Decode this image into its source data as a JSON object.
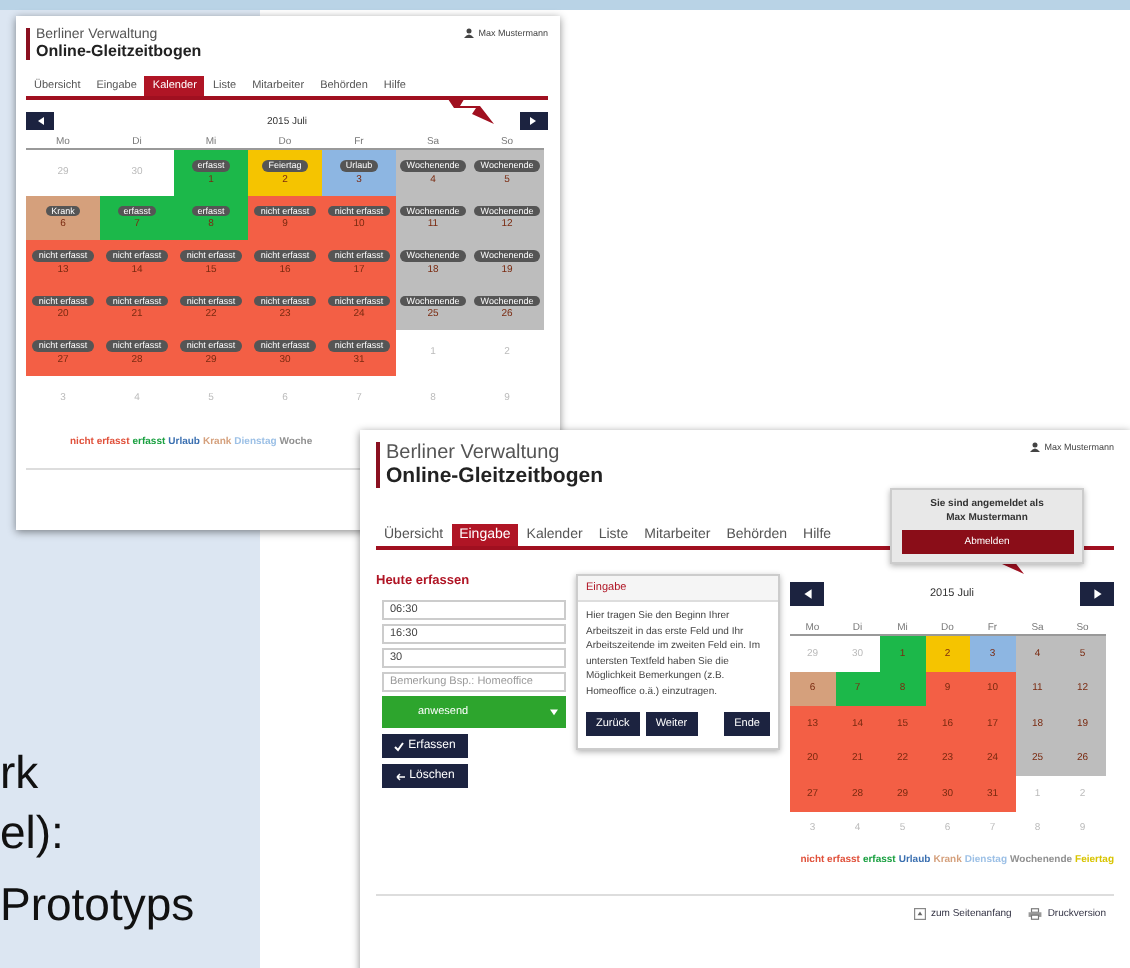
{
  "slide_text": [
    "rk",
    "el):",
    "Prototyps"
  ],
  "window_1": {
    "header": {
      "line_1": "Berliner Verwaltung",
      "line_2": "Online-Gleitzeitbogen"
    },
    "user": "Max Mustermann",
    "tabs": [
      {
        "label": "Übersicht",
        "selected": false
      },
      {
        "label": "Eingabe",
        "selected": false
      },
      {
        "label": "Kalender",
        "selected": true
      },
      {
        "label": "Liste",
        "selected": false
      },
      {
        "label": "Mitarbeiter",
        "selected": false
      },
      {
        "label": "Behörden",
        "selected": false
      },
      {
        "label": "Hilfe",
        "selected": false
      }
    ],
    "calendar": {
      "month": "2015 Juli",
      "weekdays": [
        "Mo",
        "Di",
        "Mi",
        "Do",
        "Fr",
        "Sa",
        "So"
      ],
      "weeks": [
        [
          {
            "day": "29",
            "color": "#ffffff"
          },
          {
            "day": "30",
            "color": "#ffffff"
          },
          {
            "day": "1",
            "color": "#1cb84a",
            "badge": "erfasst"
          },
          {
            "day": "2",
            "color": "#f5c400",
            "badge": "Feiertag"
          },
          {
            "day": "3",
            "color": "#8db6e2",
            "badge": "Urlaub"
          },
          {
            "day": "4",
            "color": "#bdbdbd",
            "badge": "Wochenende"
          },
          {
            "day": "5",
            "color": "#bdbdbd",
            "badge": "Wochenende"
          }
        ],
        [
          {
            "day": "6",
            "color": "#d5a07c",
            "badge": "Krank"
          },
          {
            "day": "7",
            "color": "#1cb84a",
            "badge": "erfasst"
          },
          {
            "day": "8",
            "color": "#1cb84a",
            "badge": "erfasst"
          },
          {
            "day": "9",
            "color": "#f35f45",
            "badge": "nicht erfasst"
          },
          {
            "day": "10",
            "color": "#f35f45",
            "badge": "nicht erfasst"
          },
          {
            "day": "11",
            "color": "#bdbdbd",
            "badge": "Wochenende"
          },
          {
            "day": "12",
            "color": "#bdbdbd",
            "badge": "Wochenende"
          }
        ],
        [
          {
            "day": "13",
            "color": "#f35f45",
            "badge": "nicht erfasst"
          },
          {
            "day": "14",
            "color": "#f35f45",
            "badge": "nicht erfasst"
          },
          {
            "day": "15",
            "color": "#f35f45",
            "badge": "nicht erfasst"
          },
          {
            "day": "16",
            "color": "#f35f45",
            "badge": "nicht erfasst"
          },
          {
            "day": "17",
            "color": "#f35f45",
            "badge": "nicht erfasst"
          },
          {
            "day": "18",
            "color": "#bdbdbd",
            "badge": "Wochenende"
          },
          {
            "day": "19",
            "color": "#bdbdbd",
            "badge": "Wochenende"
          }
        ],
        [
          {
            "day": "20",
            "color": "#f35f45",
            "badge": "nicht erfasst"
          },
          {
            "day": "21",
            "color": "#f35f45",
            "badge": "nicht erfasst"
          },
          {
            "day": "22",
            "color": "#f35f45",
            "badge": "nicht erfasst"
          },
          {
            "day": "23",
            "color": "#f35f45",
            "badge": "nicht erfasst"
          },
          {
            "day": "24",
            "color": "#f35f45",
            "badge": "nicht erfasst"
          },
          {
            "day": "25",
            "color": "#bdbdbd",
            "badge": "Wochenende"
          },
          {
            "day": "26",
            "color": "#bdbdbd",
            "badge": "Wochenende"
          }
        ],
        [
          {
            "day": "27",
            "color": "#f35f45",
            "badge": "nicht erfasst"
          },
          {
            "day": "28",
            "color": "#f35f45",
            "badge": "nicht erfasst"
          },
          {
            "day": "29",
            "color": "#f35f45",
            "badge": "nicht erfasst"
          },
          {
            "day": "30",
            "color": "#f35f45",
            "badge": "nicht erfasst"
          },
          {
            "day": "31",
            "color": "#f35f45",
            "badge": "nicht erfasst"
          },
          {
            "day": "1",
            "color": "#ffffff"
          },
          {
            "day": "2",
            "color": "#ffffff"
          }
        ],
        [
          {
            "day": "3",
            "color": "#ffffff"
          },
          {
            "day": "4",
            "color": "#ffffff"
          },
          {
            "day": "5",
            "color": "#ffffff"
          },
          {
            "day": "6",
            "color": "#ffffff"
          },
          {
            "day": "7",
            "color": "#ffffff"
          },
          {
            "day": "8",
            "color": "#ffffff"
          },
          {
            "day": "9",
            "color": "#ffffff"
          }
        ]
      ]
    },
    "legend": [
      {
        "label": "nicht erfasst",
        "color": "#e0503a"
      },
      {
        "label": "erfasst",
        "color": "#19a040"
      },
      {
        "label": "Urlaub",
        "color": "#3a6fb0"
      },
      {
        "label": "Krank",
        "color": "#d5a07c"
      },
      {
        "label": "Dienstag",
        "color": "#9cc0e6"
      },
      {
        "label": "Woche",
        "color": "#909090"
      }
    ]
  },
  "window_2": {
    "header": {
      "line_1": "Berliner Verwaltung",
      "line_2": "Online-Gleitzeitbogen"
    },
    "user": "Max Mustermann",
    "tabs": [
      {
        "label": "Übersicht",
        "selected": false
      },
      {
        "label": "Eingabe",
        "selected": true
      },
      {
        "label": "Kalender",
        "selected": false
      },
      {
        "label": "Liste",
        "selected": false
      },
      {
        "label": "Mitarbeiter",
        "selected": false
      },
      {
        "label": "Behörden",
        "selected": false
      },
      {
        "label": "Hilfe",
        "selected": false
      }
    ],
    "login_popup": {
      "text": "Sie sind angemeldet als Max Mustermann",
      "button": "Abmelden"
    },
    "form": {
      "heading": "Heute erfassen",
      "fields": [
        {
          "value": "06:30"
        },
        {
          "value": "16:30"
        },
        {
          "value": "30"
        },
        {
          "placeholder": "Bemerkung Bsp.: Homeoffice"
        }
      ],
      "select": "anwesend",
      "buttons": [
        {
          "label": "Erfassen",
          "kind": "check"
        },
        {
          "label": "Löschen",
          "kind": "back"
        }
      ]
    },
    "tour_popup": {
      "title": "Eingabe",
      "text": "Hier tragen Sie den Beginn Ihrer Arbeitszeit in das erste Feld und Ihr Arbeitszeitende im zweiten Feld ein. Im untersten Textfeld haben Sie die Möglichkeit Bemerkungen (z.B. Homeoffice o.ä.) einzutragen.",
      "buttons": [
        "Zurück",
        "Weiter",
        "Ende"
      ]
    },
    "calendar": {
      "month": "2015 Juli",
      "weekdays": [
        "Mo",
        "Di",
        "Mi",
        "Do",
        "Fr",
        "Sa",
        "So"
      ],
      "weeks": [
        [
          {
            "day": "29",
            "color": "#ffffff"
          },
          {
            "day": "30",
            "color": "#ffffff"
          },
          {
            "day": "1",
            "color": "#1cb84a"
          },
          {
            "day": "2",
            "color": "#f5c400"
          },
          {
            "day": "3",
            "color": "#8db6e2"
          },
          {
            "day": "4",
            "color": "#bdbdbd"
          },
          {
            "day": "5",
            "color": "#bdbdbd"
          }
        ],
        [
          {
            "day": "6",
            "color": "#d5a07c"
          },
          {
            "day": "7",
            "color": "#1cb84a"
          },
          {
            "day": "8",
            "color": "#1cb84a"
          },
          {
            "day": "9",
            "color": "#f35f45"
          },
          {
            "day": "10",
            "color": "#f35f45"
          },
          {
            "day": "11",
            "color": "#bdbdbd"
          },
          {
            "day": "12",
            "color": "#bdbdbd"
          }
        ],
        [
          {
            "day": "13",
            "color": "#f35f45"
          },
          {
            "day": "14",
            "color": "#f35f45"
          },
          {
            "day": "15",
            "color": "#f35f45"
          },
          {
            "day": "16",
            "color": "#f35f45"
          },
          {
            "day": "17",
            "color": "#f35f45"
          },
          {
            "day": "18",
            "color": "#bdbdbd"
          },
          {
            "day": "19",
            "color": "#bdbdbd"
          }
        ],
        [
          {
            "day": "20",
            "color": "#f35f45"
          },
          {
            "day": "21",
            "color": "#f35f45"
          },
          {
            "day": "22",
            "color": "#f35f45"
          },
          {
            "day": "23",
            "color": "#f35f45"
          },
          {
            "day": "24",
            "color": "#f35f45"
          },
          {
            "day": "25",
            "color": "#bdbdbd"
          },
          {
            "day": "26",
            "color": "#bdbdbd"
          }
        ],
        [
          {
            "day": "27",
            "color": "#f35f45"
          },
          {
            "day": "28",
            "color": "#f35f45"
          },
          {
            "day": "29",
            "color": "#f35f45"
          },
          {
            "day": "30",
            "color": "#f35f45"
          },
          {
            "day": "31",
            "color": "#f35f45"
          },
          {
            "day": "1",
            "color": "#ffffff"
          },
          {
            "day": "2",
            "color": "#ffffff"
          }
        ],
        [
          {
            "day": "3",
            "color": "#ffffff"
          },
          {
            "day": "4",
            "color": "#ffffff"
          },
          {
            "day": "5",
            "color": "#ffffff"
          },
          {
            "day": "6",
            "color": "#ffffff"
          },
          {
            "day": "7",
            "color": "#ffffff"
          },
          {
            "day": "8",
            "color": "#ffffff"
          },
          {
            "day": "9",
            "color": "#ffffff"
          }
        ]
      ]
    },
    "legend": [
      {
        "label": "nicht erfasst",
        "color": "#e0503a"
      },
      {
        "label": "erfasst",
        "color": "#19a040"
      },
      {
        "label": "Urlaub",
        "color": "#3a6fb0"
      },
      {
        "label": "Krank",
        "color": "#d5a07c"
      },
      {
        "label": "Dienstag",
        "color": "#9cc0e6"
      },
      {
        "label": "Wochenende",
        "color": "#909090"
      },
      {
        "label": "Feiertag",
        "color": "#d8c400"
      }
    ],
    "footer": [
      {
        "label": "zum Seitenanfang",
        "kind": "top"
      },
      {
        "label": "Druckversion",
        "kind": "print"
      }
    ]
  }
}
